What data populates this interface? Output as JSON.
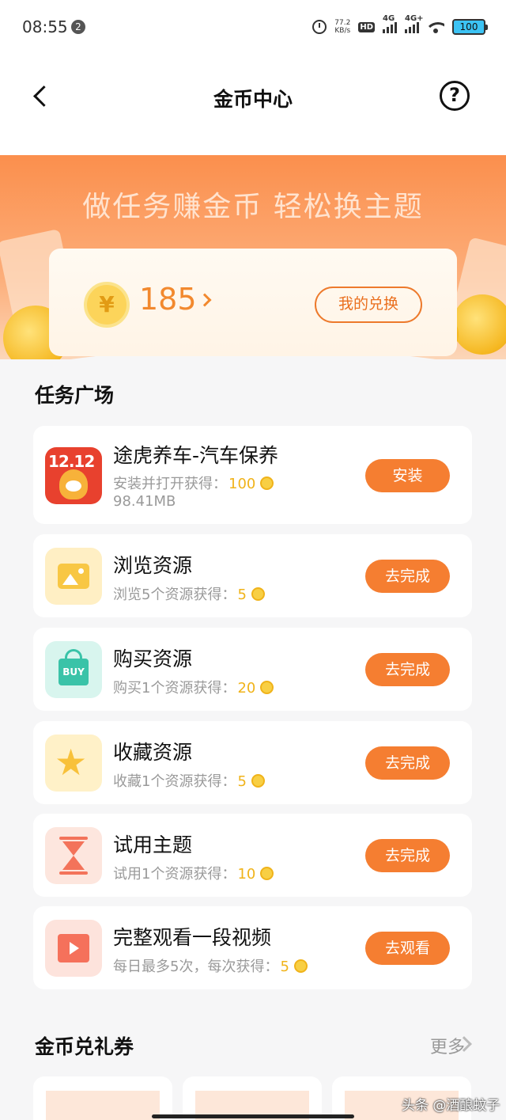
{
  "status_bar": {
    "time": "08:55",
    "notif_count": "2",
    "net_speed_value": "77.2",
    "net_speed_unit": "KB/s",
    "hd_label": "HD",
    "sim1_label": "4G",
    "sim2_label": "4G+",
    "battery": "100"
  },
  "header": {
    "title": "金币中心",
    "help_symbol": "?"
  },
  "banner": {
    "title": "做任务赚金币 轻松换主题",
    "coin_symbol": "¥",
    "balance": "185",
    "my_exchange_label": "我的兑换"
  },
  "tasks_section": {
    "title": "任务广场",
    "items": [
      {
        "name": "途虎养车-汽车保养",
        "desc": "安装并打开获得：",
        "points": "100",
        "extra": "98.41MB",
        "button": "安装",
        "icon": "tuhu-app-icon"
      },
      {
        "name": "浏览资源",
        "desc": "浏览5个资源获得：",
        "points": "5",
        "button": "去完成",
        "icon": "image-icon"
      },
      {
        "name": "购买资源",
        "desc": "购买1个资源获得：",
        "points": "20",
        "button": "去完成",
        "icon": "shopping-bag-icon"
      },
      {
        "name": "收藏资源",
        "desc": "收藏1个资源获得：",
        "points": "5",
        "button": "去完成",
        "icon": "star-icon"
      },
      {
        "name": "试用主题",
        "desc": "试用1个资源获得：",
        "points": "10",
        "button": "去完成",
        "icon": "hourglass-icon"
      },
      {
        "name": "完整观看一段视频",
        "desc": "每日最多5次，每次获得：",
        "points": "5",
        "button": "去观看",
        "icon": "video-icon"
      }
    ],
    "app_icon_text": "12.12",
    "buy_icon_text": "BUY"
  },
  "vouchers_section": {
    "title": "金币兑礼券",
    "more_label": "更多"
  },
  "watermark": "头条 @酒酿蚊子",
  "colors": {
    "accent": "#f57e31",
    "banner_orange": "#fb8f4d",
    "coin_gold": "#f8cf44"
  }
}
